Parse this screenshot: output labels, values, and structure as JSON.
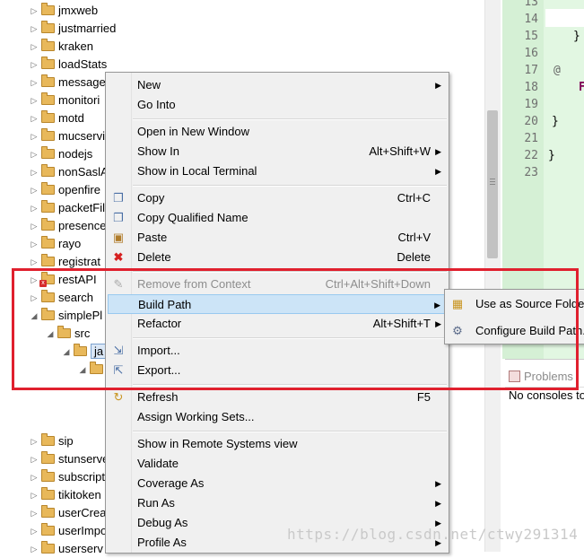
{
  "tree": {
    "items_top": [
      "jmxweb",
      "justmarried",
      "kraken",
      "loadStats",
      "message",
      "monitori",
      "motd",
      "mucservi",
      "nodejs",
      "nonSaslA",
      "openfire",
      "packetFil",
      "presence",
      "rayo",
      "registrat",
      "restAPI",
      "search",
      "simplePl",
      "src",
      "ja"
    ],
    "items_bottom": [
      "sip",
      "stunserve",
      "subscript",
      "tikitoken",
      "userCrea",
      "userImpo",
      "userserv"
    ]
  },
  "editor": {
    "line_numbers": [
      "13",
      "14",
      "15",
      "16",
      "17",
      "18",
      "19",
      "20",
      "21",
      "22",
      "23"
    ],
    "code_fragments": [
      "}",
      "@",
      "F",
      "}",
      "}"
    ]
  },
  "bottom_panel": {
    "tab_label": "Problems",
    "console_text": "No consoles to"
  },
  "context_menu": {
    "new": "New",
    "go_into": "Go Into",
    "open_new_window": "Open in New Window",
    "show_in": "Show In",
    "show_in_shortcut": "Alt+Shift+W",
    "show_in_local_terminal": "Show in Local Terminal",
    "copy": "Copy",
    "copy_shortcut": "Ctrl+C",
    "copy_qualified_name": "Copy Qualified Name",
    "paste": "Paste",
    "paste_shortcut": "Ctrl+V",
    "delete": "Delete",
    "delete_shortcut": "Delete",
    "remove_from_context": "Remove from Context",
    "remove_from_context_shortcut": "Ctrl+Alt+Shift+Down",
    "build_path": "Build Path",
    "refactor": "Refactor",
    "refactor_shortcut": "Alt+Shift+T",
    "import": "Import...",
    "export": "Export...",
    "refresh": "Refresh",
    "refresh_shortcut": "F5",
    "assign_working_sets": "Assign Working Sets...",
    "show_remote_systems": "Show in Remote Systems view",
    "validate": "Validate",
    "coverage_as": "Coverage As",
    "run_as": "Run As",
    "debug_as": "Debug As",
    "profile_as": "Profile As"
  },
  "build_path_submenu": {
    "use_as_source_folder": "Use as Source Folder",
    "configure_build_path": "Configure Build Path..."
  },
  "watermark": "https://blog.csdn.net/ctwy291314",
  "colors": {
    "highlight_box": "#e0202e",
    "menu_hover": "#cce4f7",
    "gutter": "#d5f0d5"
  }
}
